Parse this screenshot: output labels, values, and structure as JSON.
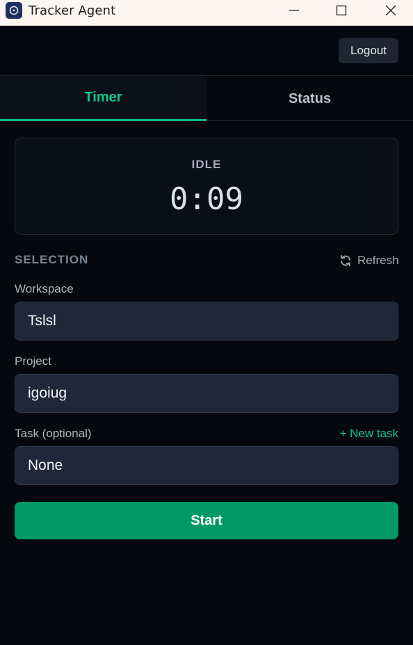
{
  "window": {
    "title": "Tracker Agent",
    "icon": "tracker-app-icon",
    "controls": [
      "minimize-icon",
      "maximize-icon",
      "close-icon"
    ]
  },
  "header": {
    "logout_label": "Logout"
  },
  "tabs": [
    {
      "label": "Timer",
      "active": true
    },
    {
      "label": "Status",
      "active": false
    }
  ],
  "timer": {
    "state": "IDLE",
    "value": "0:09"
  },
  "selection": {
    "section_label": "SELECTION",
    "refresh_label": "Refresh",
    "refresh_icon": "refresh-icon",
    "workspace_label": "Workspace",
    "workspace_value": "Tslsl",
    "project_label": "Project",
    "project_value": "igoiug",
    "task_label": "Task (optional)",
    "new_task_label": "+ New task",
    "task_value": "None"
  },
  "actions": {
    "start_label": "Start"
  },
  "colors": {
    "background": "#05080f",
    "accent": "#10b981",
    "start_button": "#019966",
    "field_bg": "#1e2838"
  }
}
